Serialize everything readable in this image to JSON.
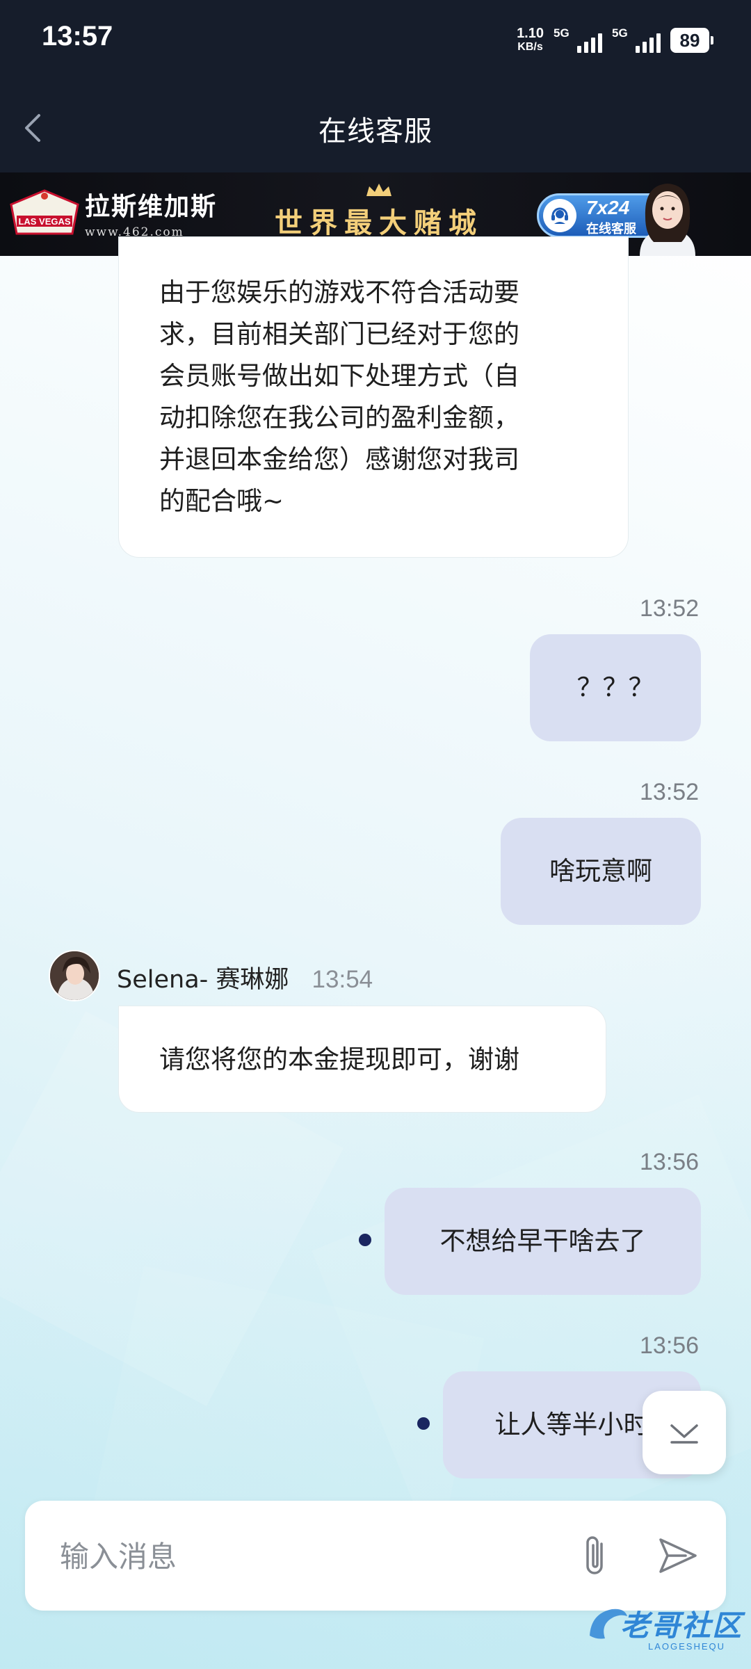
{
  "status_bar": {
    "time": "13:57",
    "net_speed_value": "1.10",
    "net_speed_unit": "KB/s",
    "sim1_label": "5G",
    "sim2_label": "5G",
    "battery": "89"
  },
  "header": {
    "title": "在线客服"
  },
  "banner": {
    "brand_name": "拉斯维加斯",
    "brand_url": "www.462.com",
    "sign_text": "LAS VEGAS",
    "slogan": "世界最大赌城",
    "service_hours": "7x24",
    "service_label": "在线客服"
  },
  "messages": [
    {
      "direction": "in",
      "lines": [
        "由于您娱乐的游戏不符合活动要",
        "求，目前相关部门已经对于您的",
        "会员账号做出如下处理方式（自",
        "动扣除您在我公司的盈利金额，",
        "并退回本金给您）感谢您对我司",
        "的配合哦~"
      ]
    },
    {
      "direction": "out",
      "time": "13:52",
      "text": "？？？"
    },
    {
      "direction": "out",
      "time": "13:52",
      "text": "啥玩意啊"
    },
    {
      "direction": "in",
      "sender": "Selena- 赛琳娜",
      "time": "13:54",
      "text": "请您将您的本金提现即可，谢谢"
    },
    {
      "direction": "out",
      "time": "13:56",
      "text": "不想给早干啥去了"
    },
    {
      "direction": "out",
      "time": "13:56",
      "text": "让人等半小时"
    }
  ],
  "input": {
    "placeholder": "输入消息"
  },
  "watermark": {
    "text": "老哥社区",
    "sub": "LAOGESHEQU"
  },
  "colors": {
    "header_bg": "#161d2b",
    "outgoing_bubble": "#d9dff2",
    "incoming_bubble": "#ffffff",
    "unread_dot": "#1a2660",
    "timestamp": "#7a7f86"
  },
  "icons": {
    "back": "chevron-left-icon",
    "attach": "paperclip-icon",
    "send": "send-arrow-icon",
    "scroll_down": "chevron-down-to-bottom-icon"
  }
}
